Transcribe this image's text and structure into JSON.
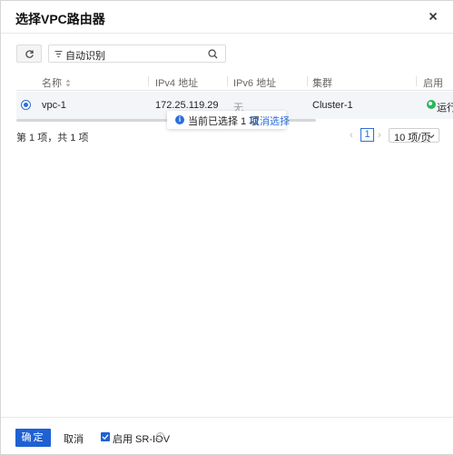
{
  "dialog": {
    "title": "选择VPC路由器",
    "close_label": "×"
  },
  "toolbar": {
    "search_value": "自动识别"
  },
  "table": {
    "columns": [
      "名称",
      "IPv4 地址",
      "IPv6 地址",
      "集群",
      "启用"
    ],
    "rows": [
      {
        "name": "vpc-1",
        "ipv4": "172.25.119.29",
        "ipv6": "无",
        "cluster": "Cluster-1",
        "status_text": "运行中",
        "selected": true
      }
    ]
  },
  "selection_tip": {
    "text": "当前已选择 1 项",
    "link": "取消选择"
  },
  "pagination": {
    "total_text": "第 1 项，共 1 项",
    "current_page": "1",
    "page_size": "10 项/页"
  },
  "footer": {
    "ok_label": "确定",
    "cancel_label": "取消",
    "sriov_label": "启用 SR-IOV",
    "sriov_checked": true
  },
  "colors": {
    "primary": "#1f61d4",
    "status_running": "#2db55d"
  }
}
